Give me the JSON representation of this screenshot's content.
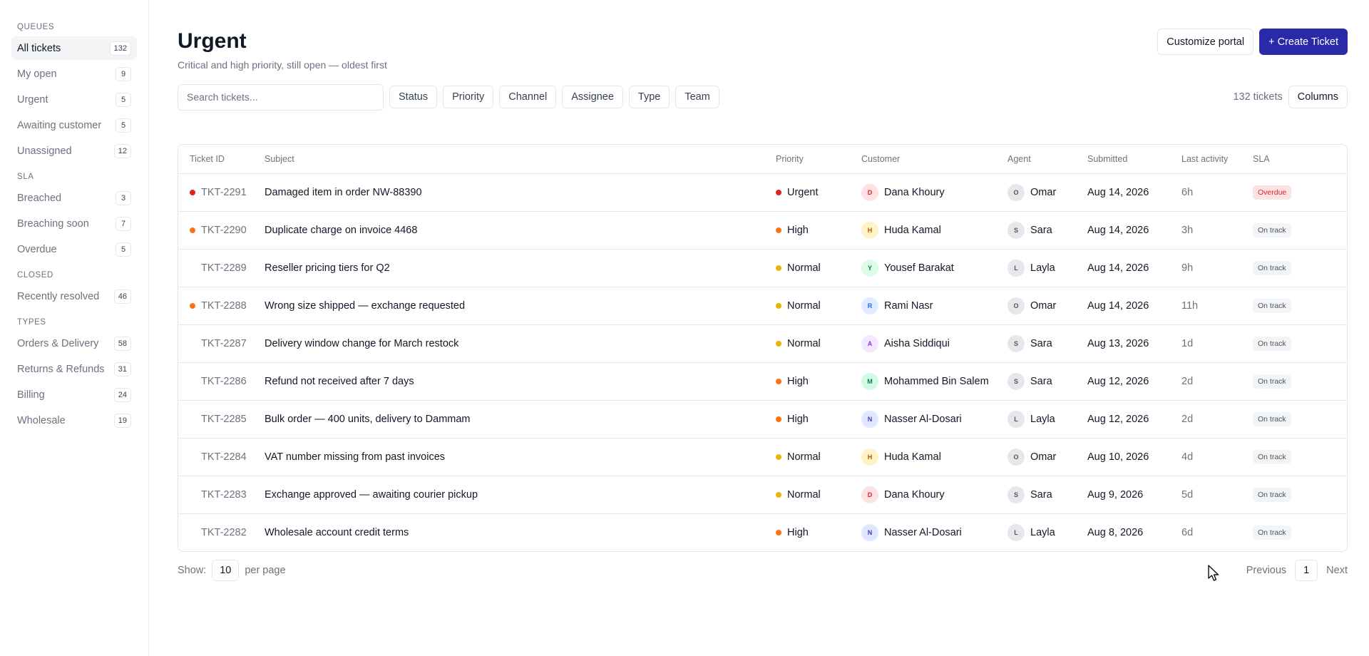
{
  "sidebar": {
    "sections": [
      {
        "heading": "QUEUES",
        "items": [
          {
            "label": "All tickets",
            "count": "132",
            "active": true
          },
          {
            "label": "My open",
            "count": "9"
          },
          {
            "label": "Urgent",
            "count": "5"
          },
          {
            "label": "Awaiting customer",
            "count": "5"
          },
          {
            "label": "Unassigned",
            "count": "12"
          }
        ]
      },
      {
        "heading": "SLA",
        "items": [
          {
            "label": "Breached",
            "count": "3"
          },
          {
            "label": "Breaching soon",
            "count": "7"
          },
          {
            "label": "Overdue",
            "count": "5"
          }
        ]
      },
      {
        "heading": "CLOSED",
        "items": [
          {
            "label": "Recently resolved",
            "count": "46"
          }
        ]
      },
      {
        "heading": "TYPES",
        "items": [
          {
            "label": "Orders & Delivery",
            "count": "58"
          },
          {
            "label": "Returns & Refunds",
            "count": "31"
          },
          {
            "label": "Billing",
            "count": "24"
          },
          {
            "label": "Wholesale",
            "count": "19"
          }
        ]
      }
    ]
  },
  "header": {
    "title": "Urgent",
    "subtitle": "Critical and high priority, still open — oldest first",
    "customize_label": "Customize portal",
    "create_label": "+ Create Ticket"
  },
  "toolbar": {
    "search_placeholder": "Search tickets...",
    "filters": [
      "Status",
      "Priority",
      "Channel",
      "Assignee",
      "Type",
      "Team"
    ],
    "ticket_count": "132 tickets",
    "columns_label": "Columns"
  },
  "table": {
    "columns": [
      "Ticket ID",
      "Subject",
      "Priority",
      "Customer",
      "Agent",
      "Submitted",
      "Last activity",
      "SLA"
    ],
    "rows": [
      {
        "id": "TKT-2291",
        "unread": "#dc2626",
        "subject": "Damaged item in order NW-88390",
        "priority": "Urgent",
        "customer": "Dana Khoury",
        "customer_initial": "D",
        "agent": "Omar",
        "agent_initial": "O",
        "submitted": "Aug 14, 2026",
        "last": "6h",
        "sla": "Overdue"
      },
      {
        "id": "TKT-2290",
        "unread": "#f97316",
        "subject": "Duplicate charge on invoice 4468",
        "priority": "High",
        "customer": "Huda Kamal",
        "customer_initial": "H",
        "agent": "Sara",
        "agent_initial": "S",
        "submitted": "Aug 14, 2026",
        "last": "3h",
        "sla": "On track"
      },
      {
        "id": "TKT-2289",
        "unread": "",
        "subject": "Reseller pricing tiers for Q2",
        "priority": "Normal",
        "customer": "Yousef Barakat",
        "customer_initial": "Y",
        "agent": "Layla",
        "agent_initial": "L",
        "submitted": "Aug 14, 2026",
        "last": "9h",
        "sla": "On track"
      },
      {
        "id": "TKT-2288",
        "unread": "#f97316",
        "subject": "Wrong size shipped — exchange requested",
        "priority": "Normal",
        "customer": "Rami Nasr",
        "customer_initial": "R",
        "agent": "Omar",
        "agent_initial": "O",
        "submitted": "Aug 14, 2026",
        "last": "11h",
        "sla": "On track"
      },
      {
        "id": "TKT-2287",
        "unread": "",
        "subject": "Delivery window change for March restock",
        "priority": "Normal",
        "customer": "Aisha Siddiqui",
        "customer_initial": "A",
        "agent": "Sara",
        "agent_initial": "S",
        "submitted": "Aug 13, 2026",
        "last": "1d",
        "sla": "On track"
      },
      {
        "id": "TKT-2286",
        "unread": "",
        "subject": "Refund not received after 7 days",
        "priority": "High",
        "customer": "Mohammed Bin Salem",
        "customer_initial": "M",
        "agent": "Sara",
        "agent_initial": "S",
        "submitted": "Aug 12, 2026",
        "last": "2d",
        "sla": "On track"
      },
      {
        "id": "TKT-2285",
        "unread": "",
        "subject": "Bulk order — 400 units, delivery to Dammam",
        "priority": "High",
        "customer": "Nasser Al-Dosari",
        "customer_initial": "N",
        "agent": "Layla",
        "agent_initial": "L",
        "submitted": "Aug 12, 2026",
        "last": "2d",
        "sla": "On track"
      },
      {
        "id": "TKT-2284",
        "unread": "",
        "subject": "VAT number missing from past invoices",
        "priority": "Normal",
        "customer": "Huda Kamal",
        "customer_initial": "H",
        "agent": "Omar",
        "agent_initial": "O",
        "submitted": "Aug 10, 2026",
        "last": "4d",
        "sla": "On track"
      },
      {
        "id": "TKT-2283",
        "unread": "",
        "subject": "Exchange approved — awaiting courier pickup",
        "priority": "Normal",
        "customer": "Dana Khoury",
        "customer_initial": "D",
        "agent": "Sara",
        "agent_initial": "S",
        "submitted": "Aug 9, 2026",
        "last": "5d",
        "sla": "On track"
      },
      {
        "id": "TKT-2282",
        "unread": "",
        "subject": "Wholesale account credit terms",
        "priority": "High",
        "customer": "Nasser Al-Dosari",
        "customer_initial": "N",
        "agent": "Layla",
        "agent_initial": "L",
        "submitted": "Aug 8, 2026",
        "last": "6d",
        "sla": "On track"
      }
    ]
  },
  "priority_colors": {
    "Urgent": "#dc2626",
    "High": "#f97316",
    "Normal": "#eab308"
  },
  "avatar_colors": {
    "D": {
      "bg": "#fde2e4",
      "fg": "#dc2626"
    },
    "H": {
      "bg": "#fef3c7",
      "fg": "#b45309"
    },
    "Y": {
      "bg": "#dcfce7",
      "fg": "#15803d"
    },
    "R": {
      "bg": "#e0ecff",
      "fg": "#2563eb"
    },
    "A": {
      "bg": "#f3e8ff",
      "fg": "#9333ea"
    },
    "M": {
      "bg": "#d1fae5",
      "fg": "#0f766e"
    },
    "N": {
      "bg": "#e0e7ff",
      "fg": "#4338ca"
    },
    "agent": {
      "bg": "#e5e7eb",
      "fg": "#4b5563"
    }
  },
  "footer": {
    "show_label": "Show:",
    "per_page_value": "10",
    "per_page_label": "per page",
    "previous_label": "Previous",
    "current_page": "1",
    "next_label": "Next"
  }
}
